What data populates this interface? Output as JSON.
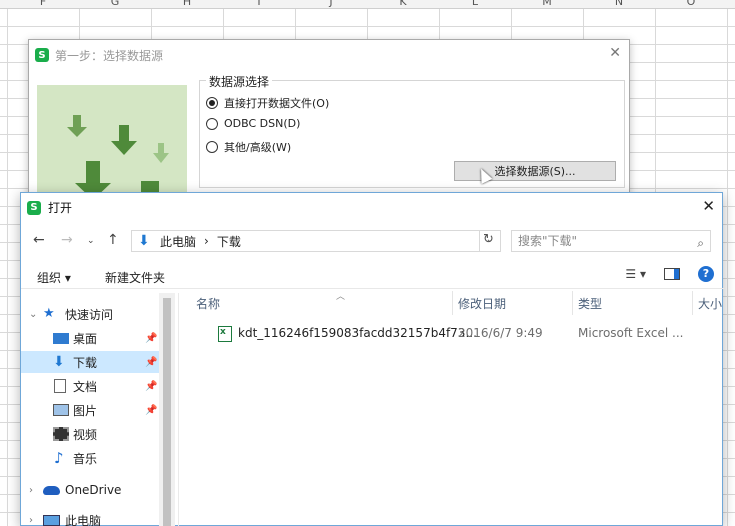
{
  "spreadsheet": {
    "columns": [
      "F",
      "G",
      "H",
      "I",
      "J",
      "K",
      "L",
      "M",
      "N",
      "O"
    ]
  },
  "wizard": {
    "title": "第一步：选择数据源",
    "group_label": "数据源选择",
    "options": [
      {
        "label": "直接打开数据文件(O)",
        "checked": true
      },
      {
        "label": "ODBC DSN(D)",
        "checked": false
      },
      {
        "label": "其他/高级(W)",
        "checked": false
      }
    ],
    "select_button": "选择数据源(S)..."
  },
  "open_dialog": {
    "title": "打开",
    "breadcrumb": [
      "此电脑",
      "下载"
    ],
    "search_placeholder": "搜索\"下载\"",
    "toolbar": {
      "organize": "组织 ▾",
      "new_folder": "新建文件夹"
    },
    "sidebar": [
      {
        "label": "快速访问",
        "icon": "star-icon",
        "pinned": false
      },
      {
        "label": "桌面",
        "icon": "desktop-icon",
        "pinned": true
      },
      {
        "label": "下载",
        "icon": "download-icon",
        "pinned": true,
        "selected": true
      },
      {
        "label": "文档",
        "icon": "document-icon",
        "pinned": true
      },
      {
        "label": "图片",
        "icon": "picture-icon",
        "pinned": true
      },
      {
        "label": "视频",
        "icon": "video-icon",
        "pinned": false
      },
      {
        "label": "音乐",
        "icon": "music-icon",
        "pinned": false
      },
      {
        "label": "OneDrive",
        "icon": "cloud-icon",
        "pinned": false
      },
      {
        "label": "此电脑",
        "icon": "computer-icon",
        "pinned": false
      }
    ],
    "columns": {
      "name": "名称",
      "modified": "修改日期",
      "type": "类型",
      "size": "大小"
    },
    "files": [
      {
        "name": "kdt_116246f159083facdd32157b4f73...",
        "modified": "2016/6/7 9:49",
        "type": "Microsoft Excel ..."
      }
    ]
  }
}
